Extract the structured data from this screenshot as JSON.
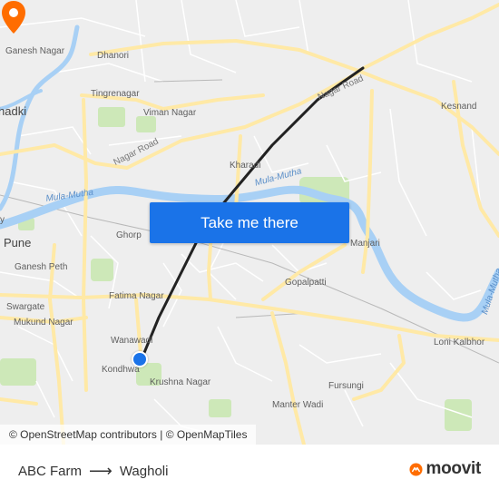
{
  "map": {
    "places": [
      {
        "id": "ganesh-nagar-n",
        "text": "Ganesh Nagar"
      },
      {
        "id": "dhanori",
        "text": "Dhanori"
      },
      {
        "id": "tingrenagar",
        "text": "Tingrenagar"
      },
      {
        "id": "viman-nagar",
        "text": "Viman Nagar"
      },
      {
        "id": "nadki",
        "text": "hadki"
      },
      {
        "id": "nagar-road-1",
        "text": "Nagar Road"
      },
      {
        "id": "nagar-road-2",
        "text": "Nagar Road"
      },
      {
        "id": "kesnand",
        "text": "Kesnand"
      },
      {
        "id": "kharadi",
        "text": "Kharadi"
      },
      {
        "id": "mula-mutha-1",
        "text": "Mula-Mutha"
      },
      {
        "id": "mula-mutha-2",
        "text": "Mula-Mutha"
      },
      {
        "id": "mula-mutha-3",
        "text": "Mula-Mutha"
      },
      {
        "id": "pune",
        "text": "Pune"
      },
      {
        "id": "ghorpadi",
        "text": "Ghorp"
      },
      {
        "id": "manjari",
        "text": "Manjari"
      },
      {
        "id": "ganesh-peth",
        "text": "Ganesh Peth"
      },
      {
        "id": "gopalpatti",
        "text": "Gopalpatti"
      },
      {
        "id": "swargate",
        "text": "Swargate"
      },
      {
        "id": "fatima-nagar",
        "text": "Fatima Nagar"
      },
      {
        "id": "mukund-nagar",
        "text": "Mukund Nagar"
      },
      {
        "id": "wanawadi",
        "text": "Wanawadi"
      },
      {
        "id": "loni-kalbhor",
        "text": "Loni Kalbhor"
      },
      {
        "id": "kondhwa",
        "text": "Kondhwa"
      },
      {
        "id": "krushna-nagar",
        "text": "Krushna Nagar"
      },
      {
        "id": "fursungi",
        "text": "Fursungi"
      },
      {
        "id": "manter-wadi",
        "text": "Manter Wadi"
      },
      {
        "id": "y-fragment",
        "text": "y"
      }
    ],
    "cta_label": "Take me there",
    "attribution": {
      "osm": "© OpenStreetMap contributors",
      "separator": " | ",
      "omt": "© OpenMapTiles"
    },
    "colors": {
      "water": "#a8d0f5",
      "road_major": "#ffe9a6",
      "road_minor": "#ffffff",
      "park": "#cde8b8",
      "route_line": "#222222",
      "start": "#1a73e8",
      "destination": "#ff6d00"
    }
  },
  "footer": {
    "origin": "ABC Farm",
    "destination": "Wagholi",
    "brand": "moovit",
    "brand_color": "#ff6d00"
  }
}
